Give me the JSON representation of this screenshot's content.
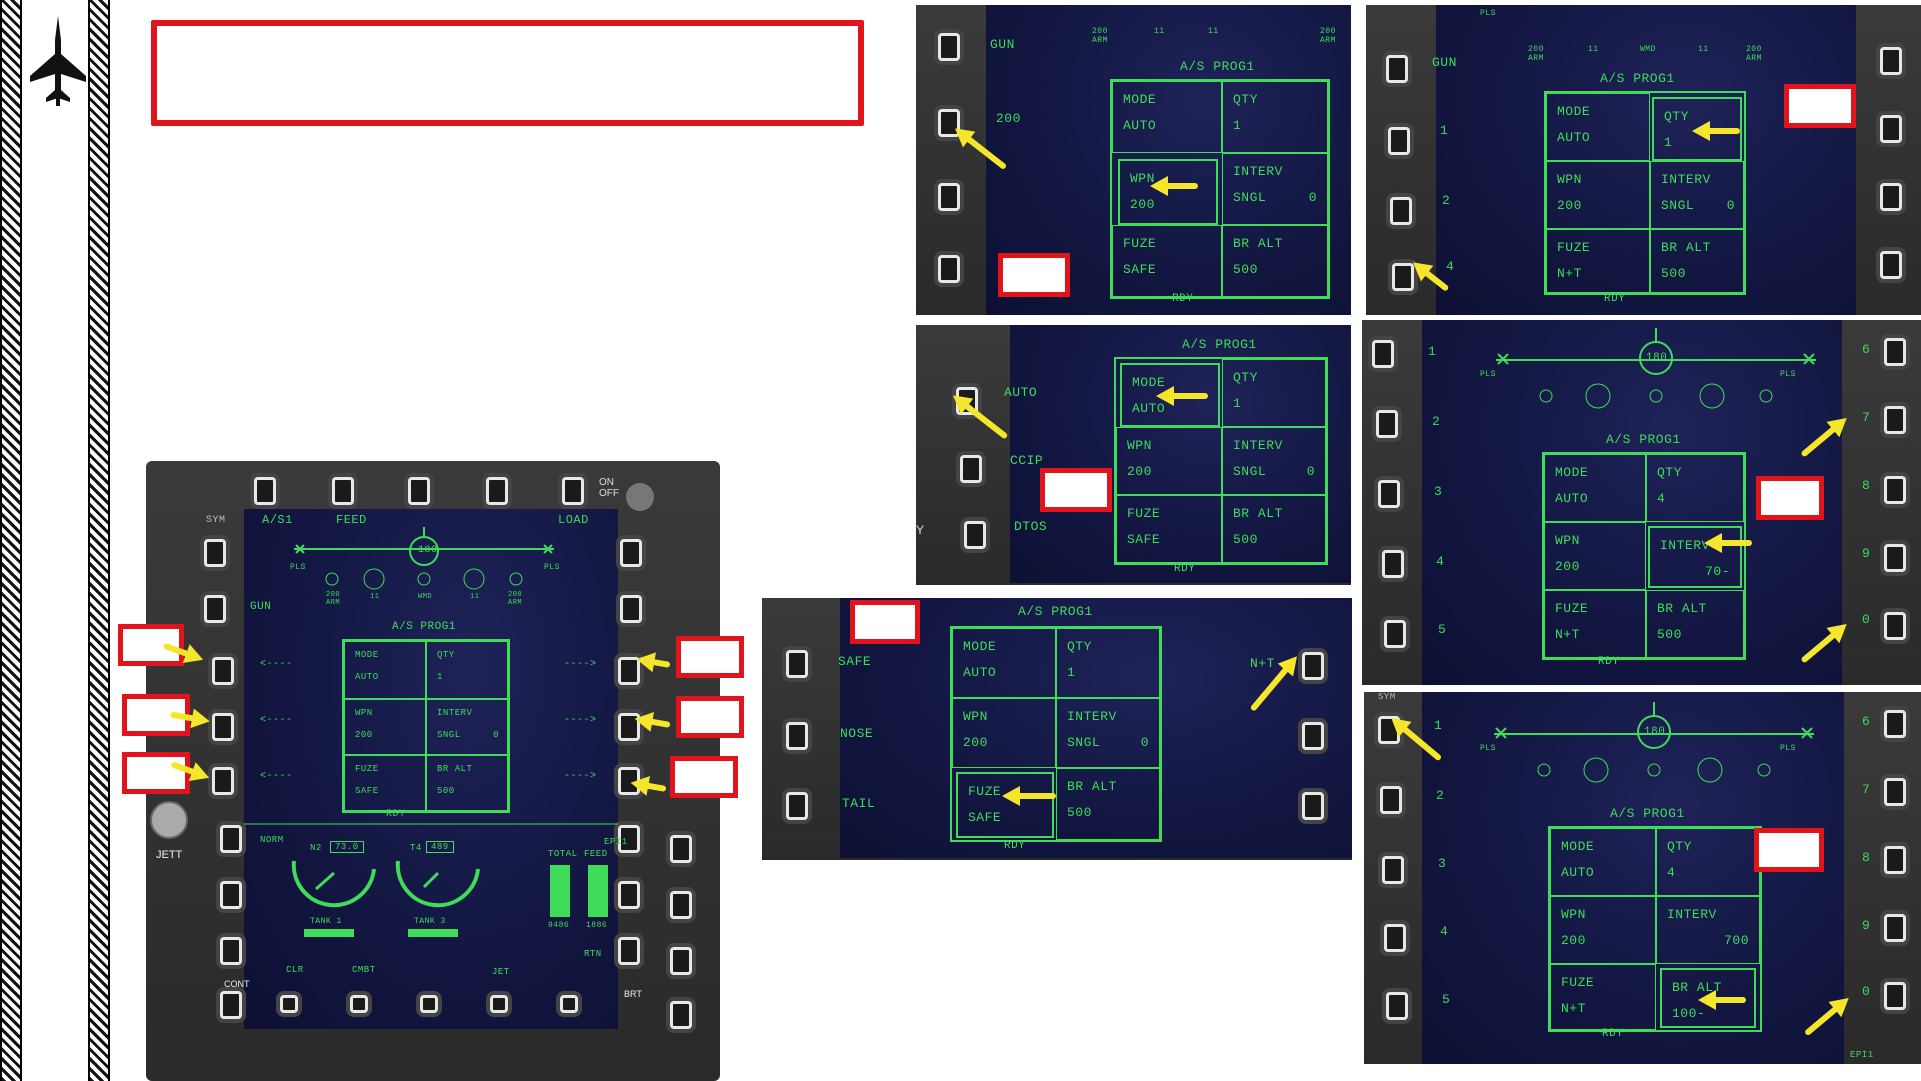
{
  "sidebar": {
    "jet_icon": "aircraft-silhouette-icon"
  },
  "title_box": {
    "text": ""
  },
  "colors": {
    "screen_green": "#3fdc5a",
    "callout_red": "#e1141c",
    "arrow_yellow": "#f5e62c",
    "screen_bg": "#121640"
  },
  "prog_page": {
    "title": "A/S PROG1",
    "rdy": "RDY",
    "mode_label": "MODE",
    "mode_value": "AUTO",
    "qty_label": "QTY",
    "qty_value": "1",
    "wpn_label": "WPN",
    "wpn_value": "200",
    "interv_label": "INTERV",
    "interv_value": "SNGL",
    "interv_zero": "0",
    "fuze_label": "FUZE",
    "fuze_value": "SAFE",
    "bralt_label": "BR ALT",
    "bralt_value": "500"
  },
  "main_mfd": {
    "top_left": "A/S1",
    "top_feed": "FEED",
    "top_load": "LOAD",
    "on_off": "ON OFF",
    "sym": "SYM",
    "gun": "GUN",
    "heading": "180",
    "pls": "PLS",
    "station_200_arm": "200 ARM",
    "station_11": "11",
    "station_wmd": "WMD",
    "left_arrows": [
      "<----",
      "<----",
      "<----"
    ],
    "right_arrows": [
      "---->",
      "---->",
      "---->"
    ],
    "norm": "NORM",
    "n2_label": "N2",
    "n2_value": "73.0",
    "t4_label": "T4",
    "t4_value": "489",
    "total": "TOTAL",
    "feed": "FEED",
    "epi": "EPI1",
    "tank1": "TANK 1",
    "tank3": "TANK 3",
    "total_value": "9486",
    "feed_value": "1886",
    "rtn": "RTN",
    "clr": "CLR",
    "cmbt": "CMBT",
    "jet": "JET",
    "jett": "JETT",
    "cont": "CONT",
    "brt": "BRT"
  },
  "panel_wpn": {
    "gun": "GUN",
    "wpn_value": "200",
    "top_arm": "200 ARM",
    "top_11": "11",
    "top_wmd": "WMD"
  },
  "panel_qty": {
    "gun": "GUN",
    "side_1": "1",
    "side_2": "2",
    "side_4": "4",
    "pls": "PLS",
    "top_arm": "200 ARM",
    "top_11": "11",
    "top_wmd": "WMD"
  },
  "panel_mode": {
    "auto": "AUTO",
    "ccip": "CCIP",
    "dtos": "DTOS",
    "y": "Y"
  },
  "panel_interv": {
    "left_nums": [
      "1",
      "2",
      "3",
      "4",
      "5"
    ],
    "right_nums": [
      "6",
      "7",
      "8",
      "9",
      "0"
    ],
    "heading": "180",
    "pls": "PLS",
    "qty_value": "4",
    "wpn_value": "200",
    "fuze_value": "N+T",
    "interv_value": "70-",
    "bralt_value": "500"
  },
  "panel_fuze": {
    "safe": "SAFE",
    "nose": "NOSE",
    "tail": "TAIL",
    "nt": "N+T"
  },
  "panel_bralt": {
    "left_nums": [
      "1",
      "2",
      "3",
      "4",
      "5"
    ],
    "right_nums": [
      "6",
      "7",
      "8",
      "9",
      "0"
    ],
    "heading": "180",
    "pls": "PLS",
    "qty_value": "4",
    "interv_value": "700",
    "fuze_value": "N+T",
    "bralt_value": "100-",
    "epi": "EPI1",
    "sym": "SYM"
  }
}
